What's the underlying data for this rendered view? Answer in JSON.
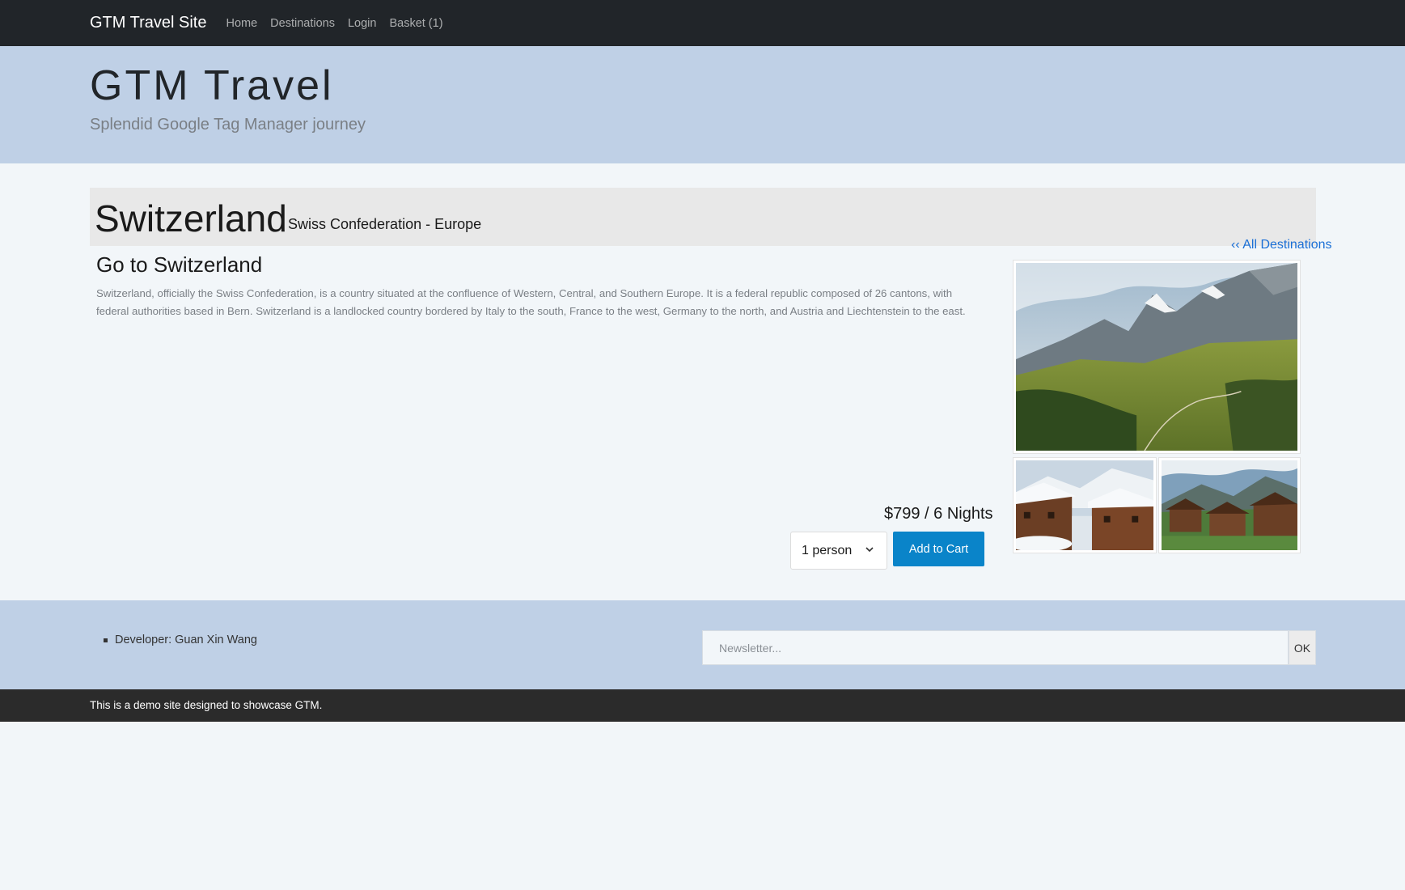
{
  "nav": {
    "brand": "GTM Travel Site",
    "links": [
      "Home",
      "Destinations",
      "Login",
      "Basket (1)"
    ]
  },
  "hero": {
    "title": "GTM Travel",
    "subtitle": "Splendid Google Tag Manager journey"
  },
  "destination": {
    "name": "Switzerland",
    "official": "Swiss Confederation - Europe",
    "back_link": "‹‹ All Destinations",
    "heading": "Go to Switzerland",
    "description": "Switzerland, officially the Swiss Confederation, is a country situated at the confluence of Western, Central, and Southern Europe. It is a federal republic composed of 26 cantons, with federal authorities based in Bern. Switzerland is a landlocked country bordered by Italy to the south, France to the west, Germany to the north, and Austria and Liechtenstein to the east.",
    "price": "$799 / 6 Nights",
    "person_select": "1 person",
    "add_to_cart": "Add to Cart"
  },
  "footer": {
    "developer": "Developer: Guan Xin Wang",
    "newsletter_placeholder": "Newsletter...",
    "ok": "OK",
    "note": "This is a demo site designed to showcase GTM."
  },
  "colors": {
    "navbar": "#212529",
    "banner": "#bfd0e6",
    "button": "#0a84c9",
    "link": "#1a6fd6"
  }
}
